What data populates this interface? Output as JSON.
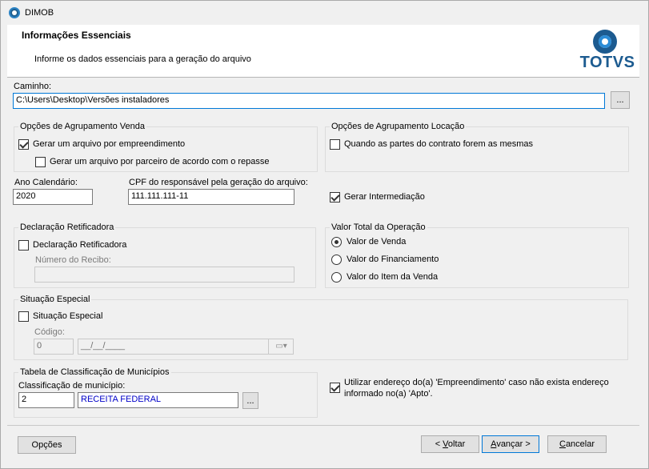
{
  "window": {
    "title": "DIMOB"
  },
  "header": {
    "title": "Informações Essenciais",
    "subtitle": "Informe os dados essenciais para a geração do arquivo",
    "brand": "TOTVS"
  },
  "path": {
    "label": "Caminho:",
    "value": "C:\\Users\\Desktop\\Versões instaladores",
    "browse_label": "..."
  },
  "agrupamento_venda": {
    "title": "Opções de Agrupamento Venda",
    "opt1": {
      "label": "Gerar um arquivo por empreendimento",
      "checked": true
    },
    "opt2": {
      "label": "Gerar um arquivo por parceiro de acordo com o repasse",
      "checked": false
    }
  },
  "agrupamento_locacao": {
    "title": "Opções de Agrupamento Locação",
    "opt1": {
      "label": "Quando as partes do contrato forem as mesmas",
      "checked": false
    }
  },
  "ano": {
    "label": "Ano Calendário:",
    "value": "2020"
  },
  "cpf": {
    "label": "CPF do responsável pela geração do arquivo:",
    "value": "111.111.111-11"
  },
  "intermediacao": {
    "label": "Gerar Intermediação",
    "checked": true
  },
  "retificadora": {
    "title": "Declaração Retificadora",
    "check_label": "Declaração Retificadora",
    "checked": false,
    "recibo_label": "Número do Recibo:",
    "recibo_value": ""
  },
  "valor_total": {
    "title": "Valor Total da Operação",
    "options": [
      "Valor de Venda",
      "Valor do Financiamento",
      "Valor do Item da Venda"
    ],
    "selected": 0
  },
  "situacao": {
    "title": "Situação Especial",
    "check_label": "Situação Especial",
    "checked": false,
    "codigo_label": "Código:",
    "codigo_value": "0",
    "date_value": "__/__/____"
  },
  "municipios": {
    "title": "Tabela de Classificação de Municípios",
    "field_label": "Classificação de município:",
    "code": "2",
    "name": "RECEITA FEDERAL",
    "browse_label": "..."
  },
  "endereco": {
    "label_line1": "Utilizar endereço do(a) 'Empreendimento' caso não exista endereço",
    "label_line2": "informado no(a) 'Apto'.",
    "checked": true
  },
  "footer": {
    "options_label": "Opções",
    "back_underline": "V",
    "back_prefix": "< ",
    "back_rest": "oltar",
    "next_underline": "A",
    "next_rest": "vançar >",
    "cancel_underline": "C",
    "cancel_rest": "ancelar"
  },
  "colors": {
    "brand": "#1c5b90",
    "link_text": "#0000c8",
    "focus": "#0078d7"
  }
}
